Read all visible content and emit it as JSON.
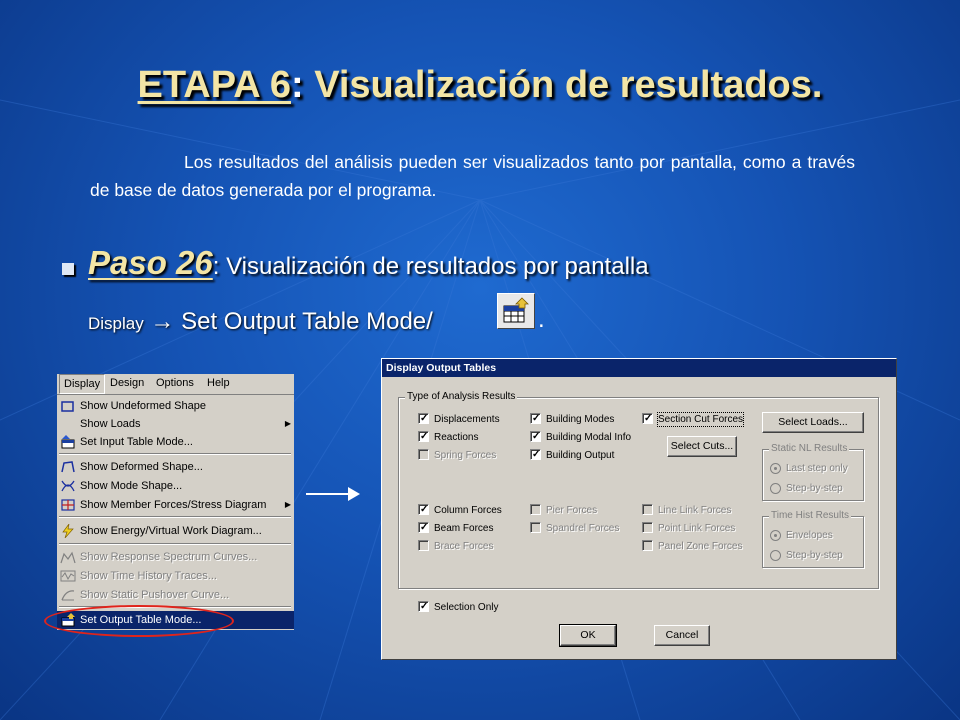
{
  "slide": {
    "title_main": "ETAPA 6",
    "title_colon": ":",
    "title_rest": " Visualización de resultados.",
    "intro": "Los resultados del análisis pueden ser visualizados tanto por pantalla, como a través de base de datos generada por el programa.",
    "step_label": "Paso 26",
    "step_colon": ":",
    "step_text": " Visualización de resultados por pantalla",
    "display_prefix": "Display",
    "display_arrow": " → ",
    "display_action": "Set Output Table Mode/",
    "display_period": "."
  },
  "menu": {
    "bar": [
      "Display",
      "Design",
      "Options",
      "Help"
    ],
    "items": [
      {
        "label": "Show Undeformed Shape",
        "icon": "undeformed-shape-icon"
      },
      {
        "label": "Show Loads",
        "submenu": true
      },
      {
        "label": "Set Input Table Mode...",
        "icon": "input-table-icon"
      },
      {
        "label": "Show Deformed Shape...",
        "icon": "deformed-shape-icon"
      },
      {
        "label": "Show Mode Shape...",
        "icon": "mode-shape-icon"
      },
      {
        "label": "Show Member Forces/Stress Diagram",
        "icon": "member-forces-icon",
        "submenu": true
      },
      {
        "label": "Show Energy/Virtual Work Diagram...",
        "icon": "energy-icon"
      },
      {
        "label": "Show Response Spectrum Curves...",
        "icon": "spectrum-icon",
        "disabled": true
      },
      {
        "label": "Show Time History Traces...",
        "icon": "time-history-icon",
        "disabled": true
      },
      {
        "label": "Show Static Pushover Curve...",
        "icon": "pushover-icon",
        "disabled": true
      },
      {
        "label": "Set Output Table Mode...",
        "icon": "output-table-icon",
        "selected": true
      }
    ]
  },
  "dialog": {
    "title": "Display Output Tables",
    "group_analysis": "Type of Analysis Results",
    "checks": {
      "displacements": {
        "label": "Displacements",
        "checked": true
      },
      "reactions": {
        "label": "Reactions",
        "checked": true
      },
      "spring_forces": {
        "label": "Spring Forces",
        "checked": false,
        "disabled": true
      },
      "building_modes": {
        "label": "Building Modes",
        "checked": true
      },
      "building_modal_info": {
        "label": "Building Modal Info",
        "checked": true
      },
      "building_output": {
        "label": "Building Output",
        "checked": true
      },
      "section_cut_forces": {
        "label": "Section Cut Forces",
        "checked": true
      },
      "column_forces": {
        "label": "Column Forces",
        "checked": true
      },
      "beam_forces": {
        "label": "Beam Forces",
        "checked": true
      },
      "brace_forces": {
        "label": "Brace Forces",
        "checked": false,
        "disabled": true
      },
      "pier_forces": {
        "label": "Pier Forces",
        "checked": false,
        "disabled": true
      },
      "spandrel_forces": {
        "label": "Spandrel Forces",
        "checked": false,
        "disabled": true
      },
      "line_link_forces": {
        "label": "Line Link Forces",
        "checked": false,
        "disabled": true
      },
      "point_link_forces": {
        "label": "Point Link Forces",
        "checked": false,
        "disabled": true
      },
      "panel_zone_forces": {
        "label": "Panel Zone Forces",
        "checked": false,
        "disabled": true
      },
      "selection_only": {
        "label": "Selection Only",
        "checked": true
      }
    },
    "buttons": {
      "select_loads": "Select Loads...",
      "select_cuts": "Select Cuts...",
      "ok": "OK",
      "cancel": "Cancel"
    },
    "static_nl": {
      "title": "Static NL Results",
      "options": [
        "Last step only",
        "Step-by-step"
      ],
      "selected": "Last step only"
    },
    "time_hist": {
      "title": "Time Hist Results",
      "options": [
        "Envelopes",
        "Step-by-step"
      ],
      "selected": "Envelopes"
    }
  },
  "colors": {
    "title_yellow": "#f3e5a5",
    "background": "#1553b4",
    "highlight_oval": "#e0241b",
    "menu_selection": "#0a246a"
  }
}
